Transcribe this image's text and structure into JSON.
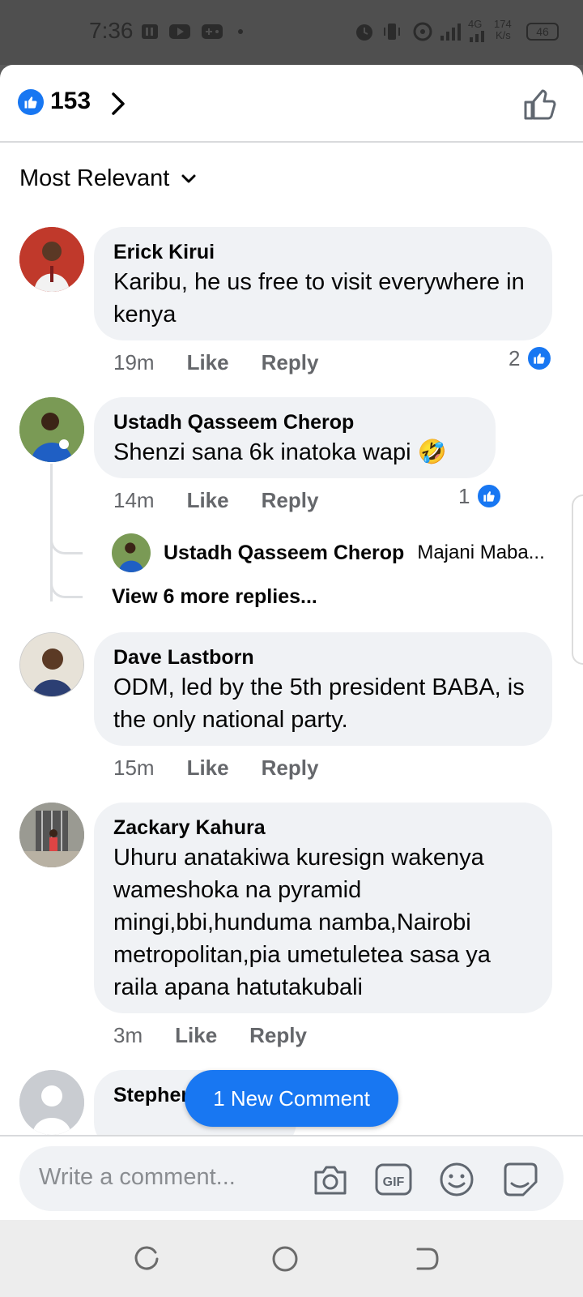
{
  "status_bar": {
    "time": "7:36",
    "network_label": "4G",
    "speed_value": "174",
    "speed_unit": "K/s",
    "battery": "46"
  },
  "reactions": {
    "count": "153"
  },
  "sort": {
    "label": "Most Relevant"
  },
  "comments": [
    {
      "author": "Erick Kirui",
      "text": "Karibu, he us free to visit everywhere in kenya",
      "time": "19m",
      "like": "Like",
      "reply": "Reply",
      "likes": "2"
    },
    {
      "author": "Ustadh Qasseem Cherop",
      "text": "Shenzi sana 6k inatoka wapi 🤣",
      "time": "14m",
      "like": "Like",
      "reply": "Reply",
      "likes": "1",
      "reply_preview": {
        "author": "Ustadh Qasseem Cherop",
        "snippet": "Majani Maba..."
      },
      "view_more": "View 6 more replies..."
    },
    {
      "author": "Dave Lastborn",
      "text": "ODM, led by the 5th president BABA, is the only national party.",
      "time": "15m",
      "like": "Like",
      "reply": "Reply"
    },
    {
      "author": "Zackary Kahura",
      "text": "Uhuru anatakiwa kuresign wakenya wameshoka na pyramid mingi,bbi,hunduma namba,Nairobi metropolitan,pia umetuletea sasa ya raila apana hatutakubali",
      "time": "3m",
      "like": "Like",
      "reply": "Reply"
    },
    {
      "author": "Stephen"
    }
  ],
  "new_comment": {
    "label": "1 New Comment"
  },
  "composer": {
    "placeholder": "Write a comment..."
  },
  "colors": {
    "accent": "#1877f2",
    "bubble": "#f0f2f5",
    "meta": "#65676b"
  }
}
